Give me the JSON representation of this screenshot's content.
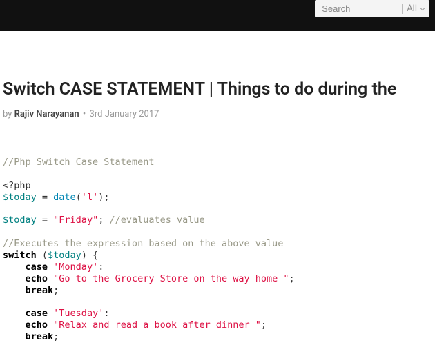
{
  "header": {
    "search_placeholder": "Search",
    "filter_label": "All"
  },
  "post": {
    "title": "Switch CASE STATEMENT | Things to do during the",
    "by_label": "by",
    "author": "Rajiv Narayanan",
    "date_sep": "•",
    "date": "3rd January 2017"
  },
  "code": {
    "l1": "//Php Switch Case Statement",
    "l2": "<?php",
    "l3_var": "$today",
    "l3_eq": " = ",
    "l3_func": "date",
    "l3_open": "(",
    "l3_arg": "'l'",
    "l3_close": ");",
    "l5_var": "$today",
    "l5_eq": " = ",
    "l5_val": "\"Friday\"",
    "l5_semi": "; ",
    "l5_comment": "//evaluates value",
    "l7": "//Executes the expression based on the above value",
    "l8_kw": "switch",
    "l8_sp": " (",
    "l8_var": "$today",
    "l8_close": ") {",
    "l9_kw": "case",
    "l9_sp": " ",
    "l9_val": "'Monday'",
    "l9_semi": ":",
    "l10_kw": "echo",
    "l10_sp": " ",
    "l10_val": "\"Go to the Grocery Store on the way home \"",
    "l10_semi": ";",
    "l11_kw": "break",
    "l11_semi": ";",
    "l13_kw": "case",
    "l13_sp": " ",
    "l13_val": "'Tuesday'",
    "l13_semi": ":",
    "l14_kw": "echo",
    "l14_sp": " ",
    "l14_val": "\"Relax and read a book after dinner \"",
    "l14_semi": ";",
    "l15_kw": "break",
    "l15_semi": ";"
  }
}
